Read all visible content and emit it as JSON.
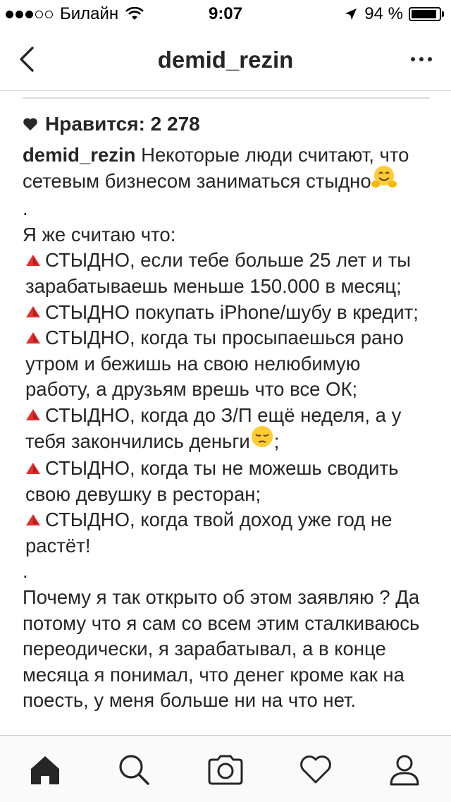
{
  "status_bar": {
    "carrier": "Билайн",
    "time": "9:07",
    "battery": "94 %",
    "battery_level": 0.94,
    "signal_bars_filled": 3,
    "signal_bars_total": 5,
    "icons": [
      "wifi-icon",
      "location-arrow-icon",
      "battery-icon"
    ]
  },
  "nav": {
    "title": "demid_rezin",
    "back_icon": "chevron-left-icon",
    "more_icon": "more-dots-icon"
  },
  "post": {
    "likes": "Нравится: 2 278",
    "username": "demid_rezin",
    "caption_lines": [
      " Некоторые люди считают, что сетевым бизнесом заниматься стыдно",
      ".",
      "Я же считаю что:",
      "СТЫДНО, если тебе больше 25 лет и ты зарабатываешь меньше 150.000 в месяц;",
      "СТЫДНО покупать iPhone/шубу в кредит;",
      "СТЫДНО, когда ты просыпаешься рано утром и бежишь на свою нелюбимую работу, а друзьям врешь что все ОК;",
      "СТЫДНО, когда до З/П ещё неделя, а у тебя закончились деньги",
      ";",
      "СТЫДНО, когда ты не можешь сводить свою девушку в ресторан;",
      "СТЫДНО, когда твой доход уже год не растёт!",
      ".",
      "Почему я так открыто об этом заявляю ? Да потому что я сам со всем этим сталкиваюсь переодически, я зарабатывал, а в конце месяца я понимал, что денег кроме как на поесть, у меня больше ни на что нет."
    ]
  },
  "tabs": [
    {
      "name": "home-icon"
    },
    {
      "name": "search-icon"
    },
    {
      "name": "camera-icon"
    },
    {
      "name": "heart-icon"
    },
    {
      "name": "profile-icon"
    }
  ],
  "colors": {
    "text": "#262626",
    "bullet_red": "#e0302f",
    "divider": "#dbdbdb",
    "tab_bar_bg": "#fafafa"
  }
}
